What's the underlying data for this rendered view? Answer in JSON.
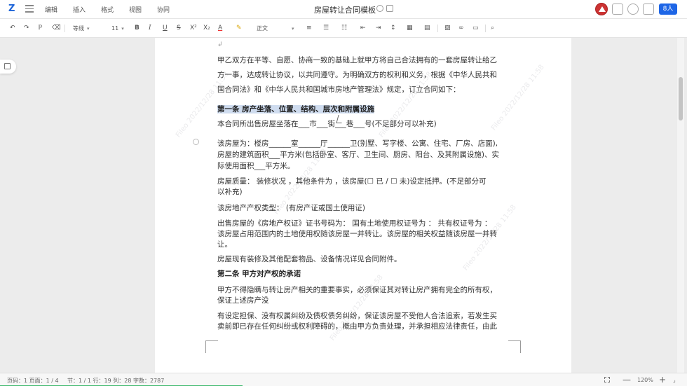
{
  "menubar": {
    "logo": "Z",
    "items": [
      "编辑",
      "插入",
      "格式",
      "视图",
      "协同"
    ],
    "doc_title": "房屋转让合同模板",
    "user_button": "8人"
  },
  "toolbar": {
    "font_family": "等线",
    "font_size": "11",
    "bold": "B",
    "italic": "I",
    "underline": "U",
    "strike": "S",
    "superscript": "X²",
    "subscript": "X₂",
    "font_color": "A",
    "highlight": "✎",
    "style": "正文"
  },
  "document": {
    "lines": [
      {
        "text": "甲乙双方在平等、自愿、协商一致的基础上就甲方将自己合法拥有的一套房屋转让给乙",
        "bold": false
      },
      {
        "text": "方一事，达成转让协议，以共同遵守。为明确双方的权利和义务，根据《中华人民共和",
        "bold": false
      },
      {
        "text": "国合同法》和《中华人民共和国城市房地产管理法》规定，订立合同如下：",
        "bold": false
      },
      {
        "text": "第一条  房产坐落、位置、结构、层次和附属设施",
        "bold": true
      },
      {
        "text": "本合同所出售房屋坐落在___市___街___巷___号(不足部分可以补充)",
        "bold": false
      },
      {
        "text": "该房屋为：楼房______室______厅______卫(别墅、写字楼、公寓、住宅、厂房、店面),",
        "bold": false
      },
      {
        "text": "房屋的建筑面积___平方米(包括卧室、客厅、卫生间、厨房、阳台、及其附属设施)、实",
        "bold": false
      },
      {
        "text": "际使用面积___平方米。",
        "bold": false
      },
      {
        "text": "房屋质量：   装修状况 ，其他条件为 ，该房屋(☐ 已 / ☐ 未)设定抵押。(不足部分可",
        "bold": false
      },
      {
        "text": "以补充)",
        "bold": false
      },
      {
        "text": "该房地产产权类型：  (有房产证或国土使用证)",
        "bold": false
      },
      {
        "text": "出售房屋的《房地产权证》证书号码为：   国有土地使用权证号为 ：   共有权证号为 ：",
        "bold": false
      },
      {
        "text": "该房屋占用范围内的土地使用权随该房屋一并转让。该房屋的相关权益随该房屋一并转",
        "bold": false
      },
      {
        "text": "让。",
        "bold": false
      },
      {
        "text": "房屋现有装修及其他配套物品、设备情况详见合同附件。",
        "bold": false
      },
      {
        "text": "第二条  甲方对产权的承诺",
        "bold": true
      },
      {
        "text": "甲方不得隐瞒与转让房产相关的重要事实，必须保证其对转让房产拥有完全的所有权，",
        "bold": false
      },
      {
        "text": "保证上述房产没",
        "bold": false
      },
      {
        "text": "有设定担保、没有权属纠纷及债权债务纠纷，保证该房屋不受他人合法追索，若发生买",
        "bold": false
      },
      {
        "text": "卖前即已存在任何纠纷或权利障碍的，概由甲方负责处理，并承担相应法律责任，由此",
        "bold": false
      }
    ],
    "watermark": "Fileo 2022/12/28 11:58"
  },
  "statusbar": {
    "page": "页码：1  页面：1 / 4",
    "section": "节：1 / 1  行：19  列：28  字数：2787",
    "zoom": "120%",
    "zoom_out": "—",
    "zoom_in": "+"
  }
}
